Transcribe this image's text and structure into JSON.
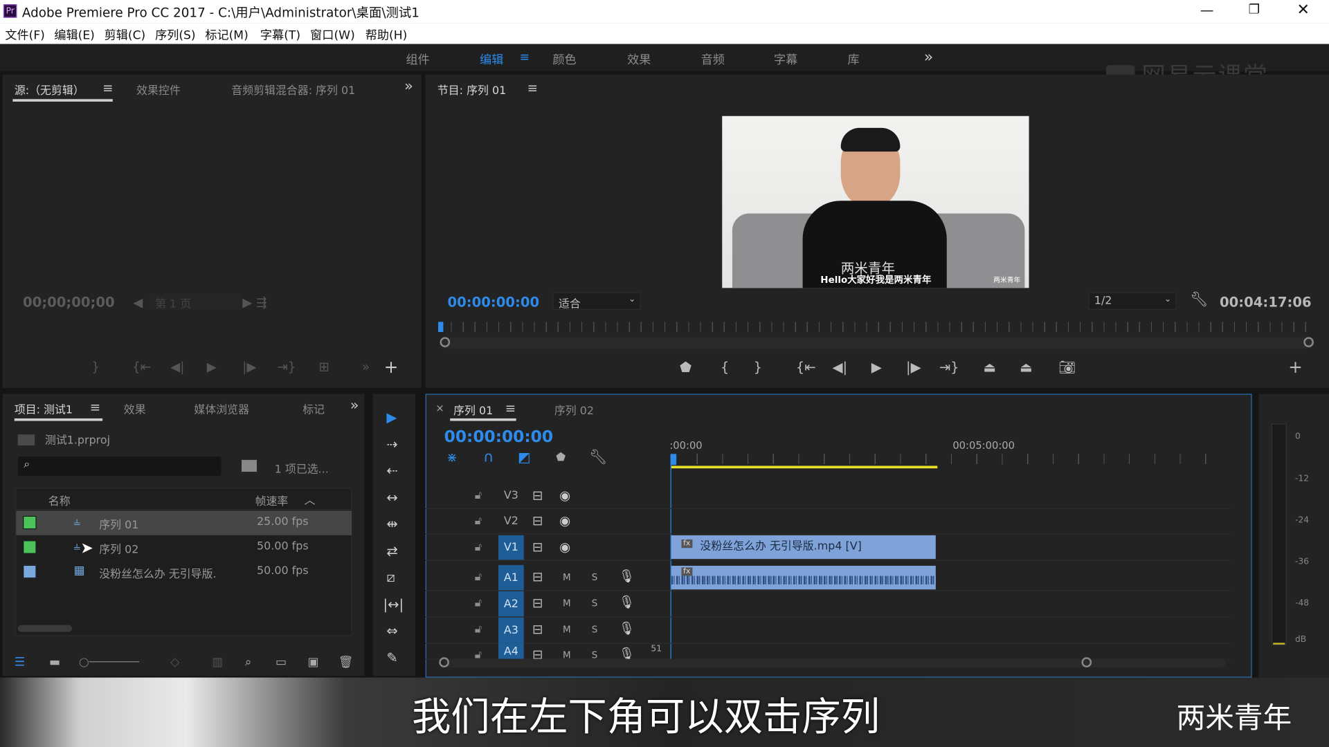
{
  "window": {
    "title": "Adobe Premiere Pro CC 2017 - C:\\用户\\Administrator\\桌面\\测试1",
    "app_icon": "Pr"
  },
  "menu": [
    "文件(F)",
    "编辑(E)",
    "剪辑(C)",
    "序列(S)",
    "标记(M)",
    "字幕(T)",
    "窗口(W)",
    "帮助(H)"
  ],
  "workspaces": {
    "items": [
      "组件",
      "编辑",
      "颜色",
      "效果",
      "音频",
      "字幕",
      "库"
    ],
    "active": "编辑",
    "more": "»"
  },
  "watermark": "网易云课堂",
  "source": {
    "tabs": [
      "源:（无剪辑）",
      "效果控件",
      "音频剪辑混合器: 序列 01"
    ],
    "timecode": "00;00;00;00",
    "page": "第 1 页"
  },
  "program": {
    "tab": "节目: 序列 01",
    "timecode": "00:00:00:00",
    "fit": "适合",
    "resolution": "1/2",
    "duration": "00:04:17:06",
    "video": {
      "shirt_text": "两米青年",
      "caption": "Hello大家好我是两米青年",
      "corner_logo": "两米青年"
    }
  },
  "project": {
    "tabs": [
      "项目: 测试1",
      "效果",
      "媒体浏览器",
      "标记"
    ],
    "file": "测试1.prproj",
    "search_placeholder": "",
    "selection": "1 项已选...",
    "columns": [
      "名称",
      "帧速率"
    ],
    "items": [
      {
        "name": "序列 01",
        "fps": "25.00 fps",
        "color": "#4cc35a",
        "type": "sequence",
        "selected": true
      },
      {
        "name": "序列 02",
        "fps": "50.00 fps",
        "color": "#4cc35a",
        "type": "sequence",
        "selected": false
      },
      {
        "name": "没粉丝怎么办 无引导版.",
        "fps": "50.00 fps",
        "color": "#7aa7dc",
        "type": "clip",
        "selected": false
      }
    ]
  },
  "timeline": {
    "tabs": [
      "序列 01",
      "序列 02"
    ],
    "close": "×",
    "timecode": "00:00:00:00",
    "ruler": [
      ":00:00",
      "00:05:00:00"
    ],
    "video_tracks": [
      "V3",
      "V2",
      "V1"
    ],
    "audio_tracks": [
      "A1",
      "A2",
      "A3",
      "A4"
    ],
    "mute": "M",
    "solo": "S",
    "clip_video": "没粉丝怎么办 无引导版.mp4 [V]",
    "fx": "fx",
    "a4_value": "51"
  },
  "meters": [
    "0",
    "-12",
    "-24",
    "-36",
    "-48",
    "dB"
  ],
  "subtitle": {
    "text": "我们在左下角可以双击序列",
    "brand": "两米青年"
  },
  "colors": {
    "accent": "#2d8ceb",
    "work_area": "#e6e02a",
    "clip": "#7fa3d8",
    "panel": "#232323"
  }
}
